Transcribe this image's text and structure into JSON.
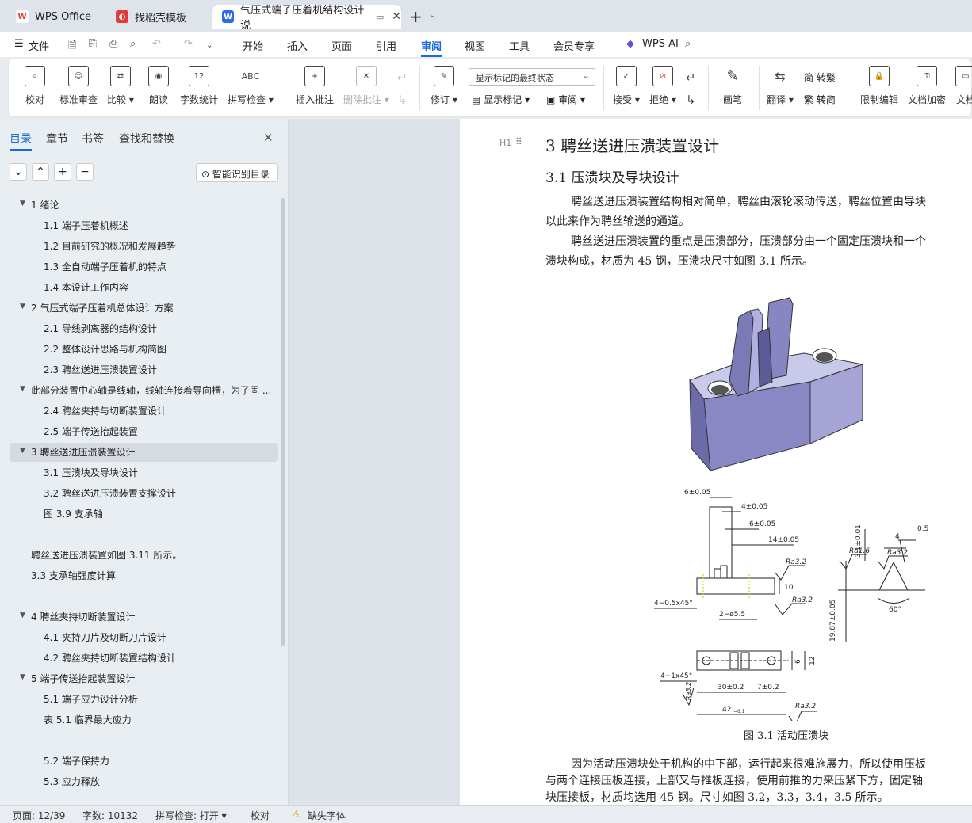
{
  "tabs": [
    {
      "label": "WPS Office",
      "icon": "wps-logo-icon"
    },
    {
      "label": "找稻壳模板",
      "icon": "docer-icon"
    },
    {
      "label": "气压式端子压着机结构设计 说",
      "icon": "writer-doc-icon"
    }
  ],
  "menu": {
    "file": "文件",
    "items": [
      "开始",
      "插入",
      "页面",
      "引用",
      "审阅",
      "视图",
      "工具",
      "会员专享"
    ],
    "active": "审阅",
    "ai": "WPS AI"
  },
  "ribbon": {
    "proof": "校对",
    "std_review": "标准审查",
    "compare": "比较",
    "read_aloud": "朗读",
    "word_count": "字数统计",
    "spell_check": "拼写检查",
    "insert_comment": "插入批注",
    "delete_comment": "删除批注",
    "track": "修订",
    "display_select": "显示标记的最终状态",
    "show_markup": "显示标记",
    "review": "审阅",
    "accept": "接受",
    "reject": "拒绝",
    "ink": "画笔",
    "translate": "翻译",
    "to_trad": "简 转繁",
    "to_simp": "繁 转简",
    "restrict": "限制编辑",
    "encrypt": "文档加密",
    "doc_more": "文档"
  },
  "sidebar": {
    "tabs": [
      "目录",
      "章节",
      "书签",
      "查找和替换"
    ],
    "smart_toc": "智能识别目录",
    "toc": [
      {
        "text": "1   绪论",
        "level": 1,
        "arrow": true
      },
      {
        "text": "1.1    端子压着机概述",
        "level": 2
      },
      {
        "text": "1.2    目前研究的概况和发展趋势",
        "level": 2
      },
      {
        "text": "1.3    全自动端子压着机的特点",
        "level": 2
      },
      {
        "text": "1.4    本设计工作内容",
        "level": 2
      },
      {
        "text": "2   气压式端子压着机总体设计方案",
        "level": 1,
        "arrow": true
      },
      {
        "text": "2.1    导线剥离器的结构设计",
        "level": 2
      },
      {
        "text": "2.2    整体设计思路与机构简图",
        "level": 2
      },
      {
        "text": "2.3    聘丝送进压溃装置设计",
        "level": 2
      },
      {
        "text": "此部分装置中心轴是线轴，线轴连接着导向槽，为了固 ...",
        "level": 1,
        "arrow": true
      },
      {
        "text": "2.4    聘丝夹持与切断装置设计",
        "level": 2
      },
      {
        "text": "2.5    端子传送抬起装置",
        "level": 2
      },
      {
        "text": "3   聘丝送进压溃装置设计",
        "level": 1,
        "arrow": true,
        "selected": true
      },
      {
        "text": "3.1    压溃块及导块设计",
        "level": 2
      },
      {
        "text": "3.2    聘丝送进压溃装置支撑设计",
        "level": 2
      },
      {
        "text": "图 3.9    支承轴",
        "level": 2
      },
      {
        "text": "",
        "level": 0
      },
      {
        "text": "聘丝送进压溃装置如图 3.11 所示。",
        "level": 0
      },
      {
        "text": "3.3    支承轴强度计算",
        "level": 0
      },
      {
        "text": "",
        "level": 0
      },
      {
        "text": "4   聘丝夹持切断装置设计",
        "level": 1,
        "arrow": true
      },
      {
        "text": "4.1    夹持刀片及切断刀片设计",
        "level": 2
      },
      {
        "text": "4.2    聘丝夹持切断装置结构设计",
        "level": 2
      },
      {
        "text": "5   端子传送抬起装置设计",
        "level": 1,
        "arrow": true
      },
      {
        "text": "5.1    端子应力设计分析",
        "level": 2
      },
      {
        "text": "表 5.1 临界最大应力",
        "level": 2
      },
      {
        "text": "",
        "level": 0
      },
      {
        "text": "5.2    端子保持力",
        "level": 2
      },
      {
        "text": "5.3    应力释放",
        "level": 2
      }
    ]
  },
  "document": {
    "h1": "3   聘丝送进压溃装置设计",
    "h2": "3.1   压溃块及导块设计",
    "para1": [
      "聘丝送进压溃装置结构相对简单，聘丝由滚轮滚动传送，聘丝位置由导块",
      "以此来作为聘丝输送的通道。"
    ],
    "para2": [
      "聘丝送进压溃装置的重点是压溃部分，压溃部分由一个固定压溃块和一个",
      "溃块构成，材质为 45 钢，压溃块尺寸如图 3.1 所示。"
    ],
    "figure_caption": "图 3.1   活动压溃块",
    "para3": [
      "因为活动压溃块处于机构的中下部，运行起来很难施展力，所以使用压板",
      "与两个连接压板连接，上部又与推板连接，使用前推的力来压紧下方，固定轴",
      "块压接板，材质均选用 45 钢。尺寸如图 3.2，3.3，3.4，3.5 所示。"
    ],
    "heading_marker": "H1",
    "dims": {
      "d1": "6±0.05",
      "d2": "4±0.05",
      "d3": "6±0.05",
      "d4": "14±0.05",
      "ra": "Ra3.2",
      "d10": "10",
      "chamfer1": "4−0.5x45°",
      "holes": "2−ø5.5",
      "d19": "19.87±0.05",
      "d31": "3.1±0.01",
      "d4b": "4",
      "d05": "0.5",
      "ra16": "Ra1.6",
      "deg60": "60°",
      "chamfer2": "4−1x45°",
      "d30": "30±0.2",
      "d7": "7±0.2",
      "d42": "42",
      "d42tol": "−0.1",
      "d12": "12",
      "d6": "6"
    }
  },
  "status": {
    "page": "页面: 12/39",
    "words": "字数: 10132",
    "spell": "拼写检查: 打开",
    "proof": "校对",
    "missing_font": "缺失字体"
  }
}
